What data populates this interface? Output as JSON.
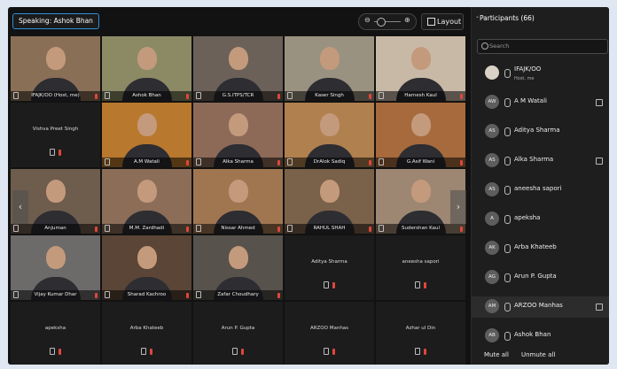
{
  "toolbar": {
    "speaking_label": "Speaking: Ashok Bhan",
    "zoom_minus": "⊖",
    "zoom_plus": "⊕",
    "layout_label": "Layout"
  },
  "grid": {
    "video_tiles": [
      {
        "name": "IFAJK/OO (Host, me)",
        "scene": "#8a6f57"
      },
      {
        "name": "Ashok Bhan",
        "scene": "#8b8a65"
      },
      {
        "name": "G.S.ITPS/TCR",
        "scene": "#6b6158"
      },
      {
        "name": "Kaser Singh",
        "scene": "#9a9280"
      },
      {
        "name": "Harnesh Kaul",
        "scene": "#c8b9a6"
      },
      {
        "name": "A.M Watali",
        "scene": "#b8782e"
      },
      {
        "name": "Alka Sharma",
        "scene": "#8d6a58"
      },
      {
        "name": "DrAlok Sadiq",
        "scene": "#b0804e"
      },
      {
        "name": "G.Asif Wani",
        "scene": "#a66a3c"
      },
      {
        "name": "Anjuman",
        "scene": "#6e5c4c"
      },
      {
        "name": "M.M. Zardhadi",
        "scene": "#8b6d58"
      },
      {
        "name": "Nissar Ahmed",
        "scene": "#a07651"
      },
      {
        "name": "RAHUL SHAH",
        "scene": "#7a6149"
      },
      {
        "name": "Sudershan Kaul",
        "scene": "#9d8772"
      },
      {
        "name": "Vijay Kumar Dhar",
        "scene": "#6c6b6a"
      },
      {
        "name": "Sharad Kachroo",
        "scene": "#5a4536"
      },
      {
        "name": "Zafar Choudhary",
        "scene": "#58524c"
      }
    ],
    "name_tiles": [
      {
        "name": "Vishva Preet Singh"
      },
      {
        "name": "Aditya Sharma"
      },
      {
        "name": "aneesha sapori"
      },
      {
        "name": "apeksha"
      },
      {
        "name": "Arba Khateeb"
      },
      {
        "name": "Arun P. Gupta"
      },
      {
        "name": "ARZOO Manhas"
      },
      {
        "name": "Azhar ul Din"
      }
    ],
    "prev_icon": "‹",
    "next_icon": "›"
  },
  "participants": {
    "title": "Participants (66)",
    "chevron": "⌄",
    "search_placeholder": "Search",
    "list": [
      {
        "initials": "",
        "name": "IFAJK/OO",
        "sub": "Host, me",
        "photo": true,
        "cam": false
      },
      {
        "initials": "AW",
        "name": "A M Watali",
        "sub": "",
        "photo": false,
        "cam": true
      },
      {
        "initials": "AS",
        "name": "Aditya Sharma",
        "sub": "",
        "photo": false,
        "cam": false
      },
      {
        "initials": "AS",
        "name": "Alka Sharma",
        "sub": "",
        "photo": false,
        "cam": true
      },
      {
        "initials": "AS",
        "name": "aneesha sapori",
        "sub": "",
        "photo": false,
        "cam": false
      },
      {
        "initials": "A",
        "name": "apeksha",
        "sub": "",
        "photo": false,
        "cam": false
      },
      {
        "initials": "AK",
        "name": "Arba Khateeb",
        "sub": "",
        "photo": false,
        "cam": false
      },
      {
        "initials": "AG",
        "name": "Arun P. Gupta",
        "sub": "",
        "photo": false,
        "cam": false
      },
      {
        "initials": "AM",
        "name": "ARZOO Manhas",
        "sub": "",
        "photo": false,
        "cam": true
      },
      {
        "initials": "AB",
        "name": "Ashok Bhan",
        "sub": "",
        "photo": false,
        "cam": false
      }
    ],
    "mute_all": "Mute all",
    "unmute_all": "Unmute all"
  }
}
